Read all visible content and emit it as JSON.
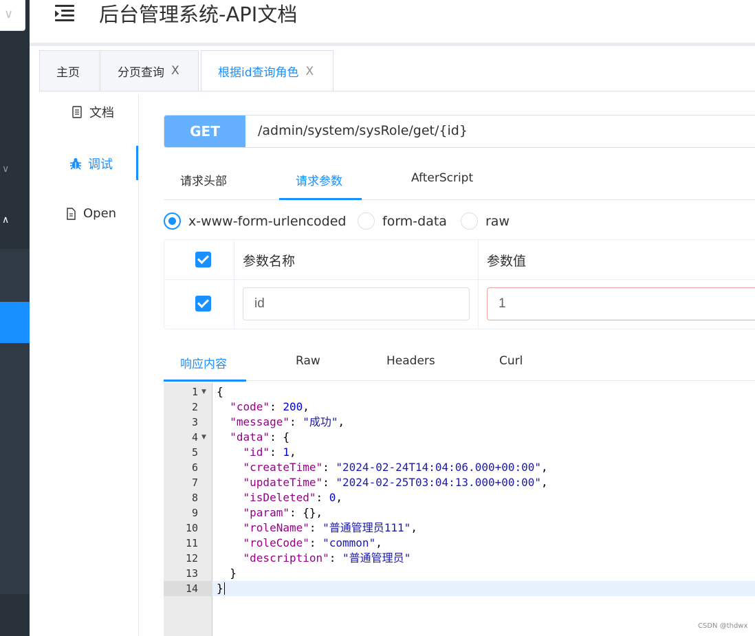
{
  "header": {
    "title": "后台管理系统-API文档"
  },
  "tabs": [
    {
      "label": "主页",
      "closable": false
    },
    {
      "label": "分页查询",
      "closable": true
    },
    {
      "label": "根据id查询角色",
      "closable": true,
      "active": true
    }
  ],
  "tab_close_glyph": "X",
  "docmenu": {
    "doc": "文档",
    "debug": "调试",
    "open": "Open"
  },
  "request": {
    "method": "GET",
    "path": "/admin/system/sysRole/get/{id}"
  },
  "subtabs": [
    "请求头部",
    "请求参数",
    "AfterScript"
  ],
  "body_types": {
    "urlencoded": "x-www-form-urlencoded",
    "formdata": "form-data",
    "raw": "raw",
    "selected": "x-www-form-urlencoded"
  },
  "params_table": {
    "col_name": "参数名称",
    "col_value": "参数值",
    "rows": [
      {
        "checked": true,
        "name": "id",
        "value": "1"
      }
    ]
  },
  "response_tabs": [
    "响应内容",
    "Raw",
    "Headers",
    "Curl"
  ],
  "response": {
    "lines": [
      "1",
      "2",
      "3",
      "4",
      "5",
      "6",
      "7",
      "8",
      "9",
      "10",
      "11",
      "12",
      "13",
      "14"
    ],
    "code": 200,
    "message": "成功",
    "data": {
      "id": 1,
      "createTime": "2024-02-24T14:04:06.000+00:00",
      "updateTime": "2024-02-25T03:04:13.000+00:00",
      "isDeleted": 0,
      "param": "{}",
      "roleName": "普通管理员111",
      "roleCode": "common",
      "description": "普通管理员"
    }
  },
  "watermark": "CSDN @thdwx",
  "colors": {
    "accent": "#1890ff",
    "method_bg": "#66b1ff",
    "sidebar_bg": "#29323b"
  }
}
